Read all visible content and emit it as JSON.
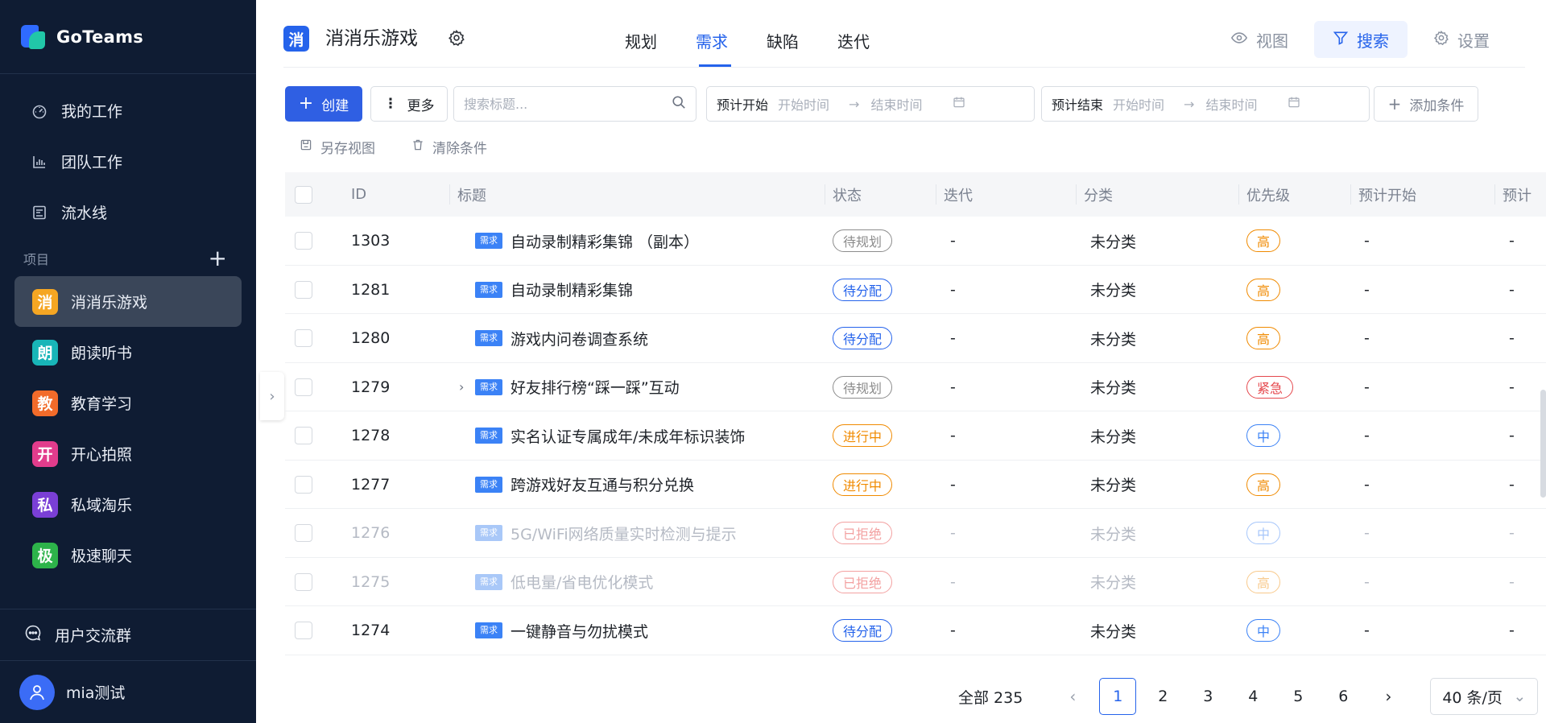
{
  "app": {
    "name": "GoTeams"
  },
  "sidebar": {
    "nav": [
      {
        "label": "我的工作",
        "icon": "dashboard-icon"
      },
      {
        "label": "团队工作",
        "icon": "bar-chart-icon"
      },
      {
        "label": "流水线",
        "icon": "pipeline-icon"
      }
    ],
    "projects_title": "项目",
    "projects": [
      {
        "initial": "消",
        "label": "消消乐游戏",
        "color": "#f5a623",
        "active": true
      },
      {
        "initial": "朗",
        "label": "朗读听书",
        "color": "#18b5b8"
      },
      {
        "initial": "教",
        "label": "教育学习",
        "color": "#f26b2a"
      },
      {
        "initial": "开",
        "label": "开心拍照",
        "color": "#e23c8c"
      },
      {
        "initial": "私",
        "label": "私域淘乐",
        "color": "#7a3fd6"
      },
      {
        "initial": "极",
        "label": "极速聊天",
        "color": "#2db34a"
      }
    ],
    "community": "用户交流群",
    "user": "mia测试"
  },
  "header": {
    "project_icon": "消",
    "project_title": "消消乐游戏",
    "tabs": [
      "规划",
      "需求",
      "缺陷",
      "迭代"
    ],
    "active_tab": "需求",
    "tools": {
      "view": "视图",
      "search": "搜索",
      "settings": "设置"
    }
  },
  "toolbar": {
    "create": "创建",
    "more": "更多",
    "search_placeholder": "搜索标题...",
    "plan_start": {
      "label": "预计开始",
      "start": "开始时间",
      "end": "结束时间"
    },
    "plan_end": {
      "label": "预计结束",
      "start": "开始时间",
      "end": "结束时间"
    },
    "add_condition": "添加条件",
    "save_view": "另存视图",
    "clear_conditions": "清除条件"
  },
  "table": {
    "columns": [
      "ID",
      "标题",
      "状态",
      "迭代",
      "分类",
      "优先级",
      "预计开始",
      "预计"
    ],
    "type_tag": "需求",
    "rows": [
      {
        "id": "1303",
        "title": "自动录制精彩集锦 （副本）",
        "status": "待规划",
        "iteration": "-",
        "category": "未分类",
        "priority": "高",
        "start": "-",
        "end": "-"
      },
      {
        "id": "1281",
        "title": "自动录制精彩集锦",
        "status": "待分配",
        "iteration": "-",
        "category": "未分类",
        "priority": "高",
        "start": "-",
        "end": "-"
      },
      {
        "id": "1280",
        "title": "游戏内问卷调查系统",
        "status": "待分配",
        "iteration": "-",
        "category": "未分类",
        "priority": "高",
        "start": "-",
        "end": "-"
      },
      {
        "id": "1279",
        "title": "好友排行榜“踩一踩”互动",
        "status": "待规划",
        "iteration": "-",
        "category": "未分类",
        "priority": "紧急",
        "start": "-",
        "end": "-",
        "expandable": true
      },
      {
        "id": "1278",
        "title": "实名认证专属成年/未成年标识装饰",
        "status": "进行中",
        "iteration": "-",
        "category": "未分类",
        "priority": "中",
        "start": "-",
        "end": "-"
      },
      {
        "id": "1277",
        "title": "跨游戏好友互通与积分兑换",
        "status": "进行中",
        "iteration": "-",
        "category": "未分类",
        "priority": "高",
        "start": "-",
        "end": "-"
      },
      {
        "id": "1276",
        "title": "5G/WiFi网络质量实时检测与提示",
        "status": "已拒绝",
        "iteration": "-",
        "category": "未分类",
        "priority": "中",
        "start": "-",
        "end": "-",
        "dim": true
      },
      {
        "id": "1275",
        "title": "低电量/省电优化模式",
        "status": "已拒绝",
        "iteration": "-",
        "category": "未分类",
        "priority": "高",
        "start": "-",
        "end": "-",
        "dim": true
      },
      {
        "id": "1274",
        "title": "一键静音与勿扰模式",
        "status": "待分配",
        "iteration": "-",
        "category": "未分类",
        "priority": "中",
        "start": "-",
        "end": "-"
      }
    ]
  },
  "status_colors": {
    "待规划": "#8c8c8c",
    "待分配": "#2563eb",
    "进行中": "#f08a00",
    "已拒绝": "#f3a1a1"
  },
  "priority_colors": {
    "高": "#f08a00",
    "中": "#3b82f6",
    "紧急": "#e5484d"
  },
  "pagination": {
    "total": "全部 235",
    "pages": [
      "1",
      "2",
      "3",
      "4",
      "5",
      "6"
    ],
    "current": "1",
    "page_size": "40 条/页"
  }
}
